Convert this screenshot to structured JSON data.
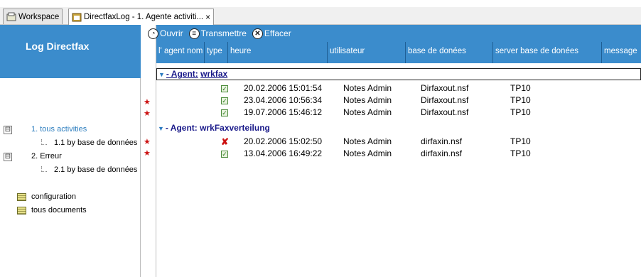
{
  "tabs": [
    {
      "label": "Workspace",
      "icon": "workspace-icon"
    },
    {
      "label": "DirectfaxLog - 1. Agente activiti...",
      "icon": "database-icon",
      "close": "×"
    }
  ],
  "left": {
    "title": "Log Directfax",
    "tree": [
      {
        "label": "1. tous activities",
        "toggle": "⊟"
      },
      {
        "label": "1.1 by base de données"
      },
      {
        "label": "2. Erreur",
        "toggle": "⊟"
      },
      {
        "label": "2.1 by base de données"
      }
    ],
    "docs": [
      {
        "label": "configuration"
      },
      {
        "label": "tous documents"
      }
    ]
  },
  "toolbar": {
    "open_label": "Ouvrir",
    "transmit_label": "Transmettre",
    "delete_label": "Effacer"
  },
  "columns": [
    "l' agent nom",
    "type",
    "heure",
    "utilisateur",
    "base de donées",
    "server base de donées",
    "message"
  ],
  "groups": [
    {
      "label": "- Agent:",
      "agent": "wrkfax",
      "rows": [
        {
          "star": false,
          "status": "ok",
          "time": "20.02.2006 15:01:54",
          "user": "Notes Admin",
          "db": "Dirfaxout.nsf",
          "server": "TP10"
        },
        {
          "star": true,
          "status": "ok",
          "time": "23.04.2006 10:56:34",
          "user": "Notes Admin",
          "db": "Dirfaxout.nsf",
          "server": "TP10"
        },
        {
          "star": true,
          "status": "ok",
          "time": "19.07.2006 15:46:12",
          "user": "Notes Admin",
          "db": "Dirfaxout.nsf",
          "server": "TP10"
        }
      ]
    },
    {
      "label": "- Agent:",
      "agent": "wrkFaxverteilung",
      "rows": [
        {
          "star": true,
          "status": "error",
          "time": "20.02.2006 15:02:50",
          "user": "Notes Admin",
          "db": "dirfaxin.nsf",
          "server": "TP10"
        },
        {
          "star": true,
          "status": "ok",
          "time": "13.04.2006 16:49:22",
          "user": "Notes Admin",
          "db": "dirfaxin.nsf",
          "server": "TP10"
        }
      ]
    }
  ],
  "colors": {
    "accent": "#3b8ccc",
    "star": "#cc1111",
    "selected": "#2f7fbf",
    "category": "#1a1a8a"
  }
}
